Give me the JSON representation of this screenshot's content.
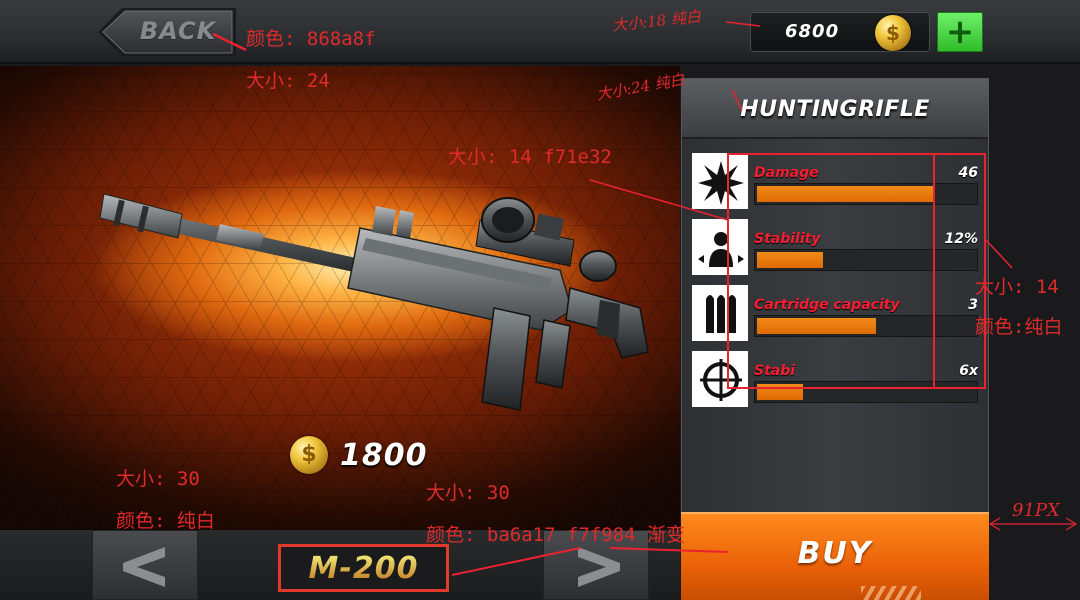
{
  "top_bar": {
    "back_label": "BACK",
    "coins": "6800",
    "add_coins_label": "+"
  },
  "weapon": {
    "name": "M-200",
    "price": "1800"
  },
  "panel": {
    "title": "HUNTINGRIFLE",
    "stats": [
      {
        "name": "Damage",
        "value": "46",
        "level": 0.8,
        "icon": "explosion-icon"
      },
      {
        "name": "Stability",
        "value": "12%",
        "level": 0.3,
        "icon": "stability-target-icon"
      },
      {
        "name": "Cartridge capacity",
        "value": "3",
        "level": 0.54,
        "icon": "bullets-icon"
      },
      {
        "name": "Stabi",
        "value": "6x",
        "level": 0.21,
        "icon": "crosshair-icon"
      }
    ],
    "buy_label": "BUY"
  },
  "annotations": {
    "back_color": "颜色: 868a8f",
    "back_size": "大小: 24",
    "coin_size": "大小:18  纯白",
    "title_size": "大小:24  纯白",
    "stat_name_style": "大小: 14 f71e32",
    "stat_value_size": "大小: 14",
    "stat_value_color": "颜色:纯白",
    "price_size": "大小: 30",
    "price_color": "颜色: 纯白",
    "name_size": "大小: 30",
    "name_color": "颜色: ba6a17  f7f984 渐变",
    "buy_width": "91PX"
  },
  "colors": {
    "back_text": "#868a8f",
    "stat_name": "#f71e32",
    "name_grad_start": "#ba6a17",
    "name_grad_end": "#f7f984",
    "accent_orange": "#ea6208",
    "plus_green": "#2fbd2a"
  }
}
